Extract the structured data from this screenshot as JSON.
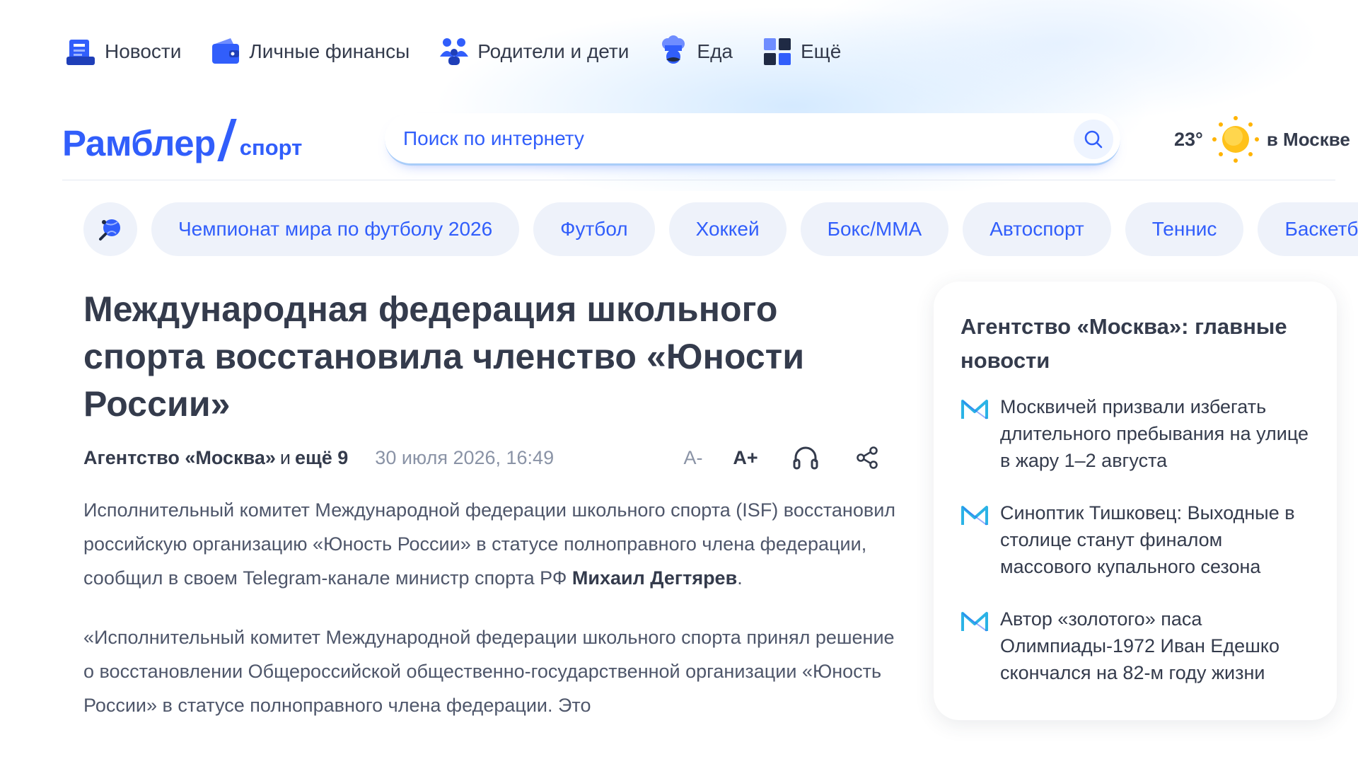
{
  "service_nav": [
    {
      "label": "Новости",
      "icon": "news-icon"
    },
    {
      "label": "Личные финансы",
      "icon": "wallet-icon"
    },
    {
      "label": "Родители и дети",
      "icon": "family-icon"
    },
    {
      "label": "Еда",
      "icon": "chef-icon"
    },
    {
      "label": "Ещё",
      "icon": "grid-icon"
    }
  ],
  "header": {
    "logo_main": "Рамблер",
    "logo_sub": "спорт",
    "search_placeholder": "Поиск по интернету",
    "weather_temp": "23°",
    "weather_city": "в Москве"
  },
  "sport_nav": [
    "Чемпионат мира по футболу 2026",
    "Футбол",
    "Хоккей",
    "Бокс/ММА",
    "Автоспорт",
    "Теннис",
    "Баскетбол"
  ],
  "article": {
    "title": "Международная федерация школьного спорта восстановила членство «Юности России»",
    "source": "Агентство «Москва»",
    "and_text": "и",
    "more_sources": "ещё 9",
    "date": "30 июля 2026, 16:49",
    "font_minus": "A-",
    "font_plus": "A+",
    "paragraph1": "Исполнительный комитет Международной федерации школьного спорта (ISF) восстановил российскую организацию «Юность России» в статусе полноправного члена федерации, сообщил в своем Telegram-канале министр спорта РФ ",
    "paragraph1_name": "Михаил Дегтярев",
    "paragraph1_end": ".",
    "paragraph2": "«Исполнительный комитет Международной федерации школьного спорта принял решение о восстановлении Общероссийской общественно-государственной организации «Юность России» в статусе полноправного члена федерации. Это"
  },
  "sidebar": {
    "title": "Агентство «Москва»: главные новости",
    "items": [
      "Москвичей призвали избегать длительного пребывания на улице в жару 1–2 августа",
      "Синоптик Тишковец: Выходные в столице станут финалом массового купального сезона",
      "Автор «золотого» паса Олимпиады-1972 Иван Едешко скончался на 82-м году жизни"
    ]
  },
  "colors": {
    "brand": "#315efb",
    "text": "#343b4c",
    "muted": "#8a93a6",
    "chip_bg": "#eef2fa"
  }
}
